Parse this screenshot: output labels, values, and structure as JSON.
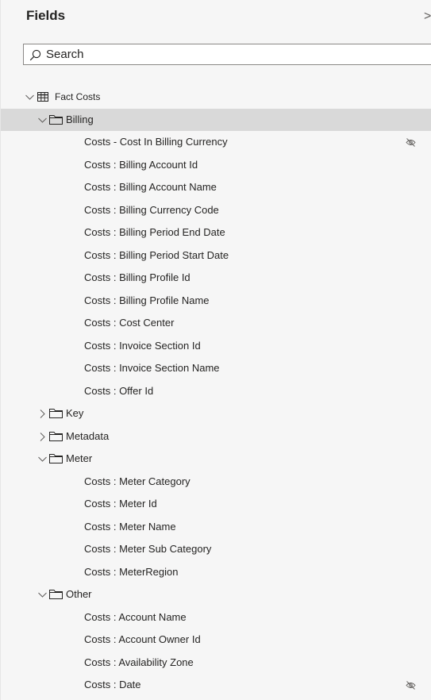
{
  "pane": {
    "title": "Fields",
    "close_glyph": ">",
    "search_placeholder": "Search"
  },
  "tree": {
    "table": {
      "label": "Fact Costs",
      "icon": "table-icon",
      "expanded": true
    },
    "groups": [
      {
        "label": "Billing",
        "expanded": true,
        "selected": true,
        "fields": [
          {
            "label": "Costs - Cost In Billing Currency",
            "hidden": true
          },
          {
            "label": "Costs : Billing Account Id",
            "hidden": false
          },
          {
            "label": "Costs : Billing Account Name",
            "hidden": false
          },
          {
            "label": "Costs : Billing Currency Code",
            "hidden": false
          },
          {
            "label": "Costs : Billing Period End Date",
            "hidden": false
          },
          {
            "label": "Costs : Billing Period Start Date",
            "hidden": false
          },
          {
            "label": "Costs : Billing Profile Id",
            "hidden": false
          },
          {
            "label": "Costs : Billing Profile Name",
            "hidden": false
          },
          {
            "label": "Costs : Cost Center",
            "hidden": false
          },
          {
            "label": "Costs : Invoice Section Id",
            "hidden": false
          },
          {
            "label": "Costs : Invoice Section Name",
            "hidden": false
          },
          {
            "label": "Costs : Offer Id",
            "hidden": false
          }
        ]
      },
      {
        "label": "Key",
        "expanded": false,
        "selected": false,
        "fields": []
      },
      {
        "label": "Metadata",
        "expanded": false,
        "selected": false,
        "fields": []
      },
      {
        "label": "Meter",
        "expanded": true,
        "selected": false,
        "fields": [
          {
            "label": "Costs : Meter Category",
            "hidden": false
          },
          {
            "label": "Costs : Meter Id",
            "hidden": false
          },
          {
            "label": "Costs : Meter Name",
            "hidden": false
          },
          {
            "label": "Costs : Meter Sub Category",
            "hidden": false
          },
          {
            "label": "Costs : MeterRegion",
            "hidden": false
          }
        ]
      },
      {
        "label": "Other",
        "expanded": true,
        "selected": false,
        "fields": [
          {
            "label": "Costs : Account Name",
            "hidden": false
          },
          {
            "label": "Costs : Account Owner Id",
            "hidden": false
          },
          {
            "label": "Costs : Availability Zone",
            "hidden": false
          },
          {
            "label": "Costs : Date",
            "hidden": true
          }
        ]
      }
    ]
  },
  "colors": {
    "selected_row": "#d9d9d9",
    "pane_bg": "#f6f6f6",
    "text": "#252423",
    "icon": "#605e5c"
  }
}
